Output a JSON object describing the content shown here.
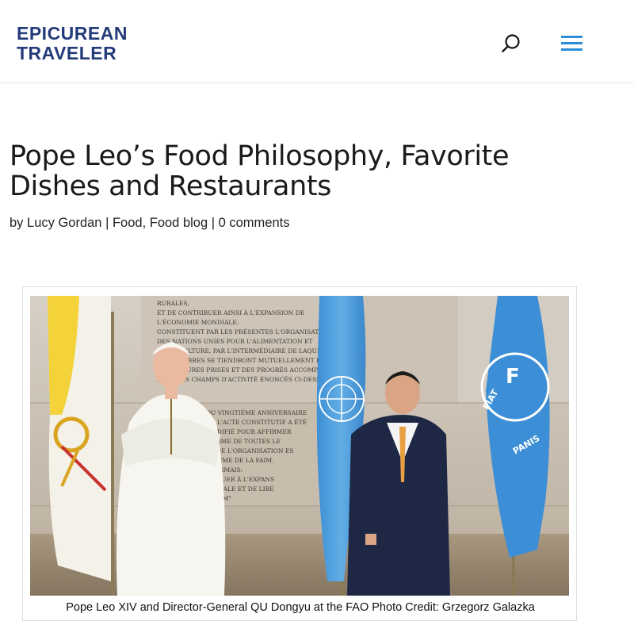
{
  "header": {
    "logo_line1": "EPICUREAN",
    "logo_line2": "TRAVELER",
    "brand_color": "#243b7a",
    "accent_color": "#2a8fd8",
    "search_icon": "search-icon",
    "menu_icon": "hamburger-menu-icon"
  },
  "article": {
    "title": "Pope Leo’s Food Philosophy, Favorite Dishes and Restaurants",
    "by": "by ",
    "author": "Lucy Gordan",
    "sep1": " | ",
    "category1": "Food",
    "comma": ", ",
    "category2": "Food blog",
    "sep2": " | ",
    "comments": "0 comments"
  },
  "figure": {
    "caption": "Pope Leo XIV and Director-General QU Dongyu at the FAO Photo Credit: Grzegorz Galazka",
    "fao_flag_text_1": "FIAT",
    "fao_flag_text_2": "PANIS",
    "fao_flag_letter": "F",
    "wall_text": [
      "RURALES,",
      "ET DE CONTRIBUER AINSI À L'EXPANSION DE",
      "L'ÉCONOMIE MONDIALE,",
      "CONSTITUENT PAR LES PRÉSENTES L'ORGANISATION",
      "DES NATIONS UNIES POUR L'ALIMENTATION ET",
      "L'AGRICULTURE, PAR L'INTERMÉDIAIRE DE LAQUELLE",
      "LES MEMBRES SE TIENDRONT MUTUELLEMENT INFORMÉS",
      "DES MESURES PRISES ET DES PROGRÈS ACCOMPLIS",
      "DANS LES CHAMPS D'ACTIVITÉ ÉNONCÉS CI-DESSUS.",
      "DU VINGTIÈME ANNIVERSAIRE",
      "DE L'ACTE CONSTITUTIF A ÉTÉ",
      "MODIFIÉ POUR AFFIRMER",
      "ULTIME DE TOUTES LE",
      "ÉS DE L'ORGANISATION ES",
      "HOMME DE LA FAIM.",
      "ÉSORMAIS:",
      "TRIBUER À L'EXPANS",
      "ONDIALE ET DE LIBÉ",
      "A FAIM\""
    ]
  }
}
